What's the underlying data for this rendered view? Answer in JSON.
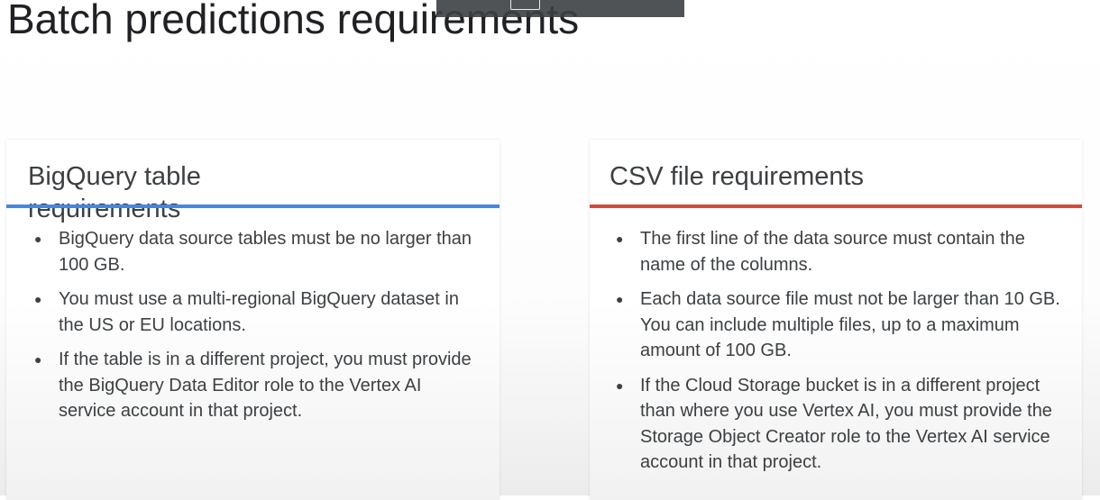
{
  "slide": {
    "title": "Batch predictions requirements"
  },
  "left_card": {
    "title": "BigQuery table requirements",
    "accent_color": "#4a86d8",
    "bullets": [
      "BigQuery data source tables must be no larger than 100 GB.",
      "You must use a multi-regional BigQuery dataset in the US or EU locations.",
      "If the table is in a different project, you must provide the BigQuery Data Editor role to the Vertex AI service account in that project."
    ]
  },
  "right_card": {
    "title": "CSV file requirements",
    "accent_color": "#c9503f",
    "bullets": [
      "The first line of the data source must contain the name of the columns.",
      "Each data source file must not be larger than 10 GB. You can include multiple files, up to a maximum amount of 100 GB.",
      "If the Cloud Storage bucket is in a different project than where you use Vertex AI, you must provide the Storage Object Creator role to the Vertex AI service account in that project."
    ]
  },
  "bullet_glyph": "●"
}
